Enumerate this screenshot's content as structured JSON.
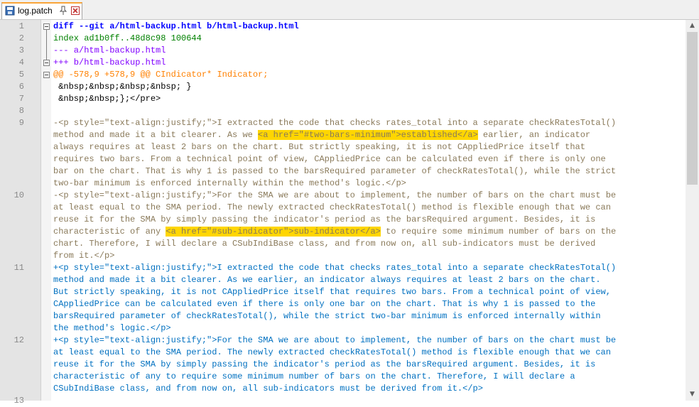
{
  "tab": {
    "label": "log.patch"
  },
  "lines": [
    {
      "num": "1",
      "cls": "c-blue",
      "rows": [
        [
          {
            "t": "diff --git a/html-backup.html b/html-backup.html"
          }
        ]
      ]
    },
    {
      "num": "2",
      "cls": "c-green",
      "rows": [
        [
          {
            "t": "index ad1b0ff..48d8c98 100644"
          }
        ]
      ]
    },
    {
      "num": "3",
      "cls": "c-purple",
      "rows": [
        [
          {
            "t": "--- a/html-backup.html"
          }
        ]
      ]
    },
    {
      "num": "4",
      "cls": "c-purple",
      "rows": [
        [
          {
            "t": "+++ b/html-backup.html"
          }
        ]
      ]
    },
    {
      "num": "5",
      "cls": "c-orange",
      "rows": [
        [
          {
            "t": "@@ -578,9 +578,9 @@ CIndicator* Indicator;"
          }
        ]
      ]
    },
    {
      "num": "6",
      "cls": "c-black",
      "rows": [
        [
          {
            "t": " &nbsp;&nbsp;&nbsp;&nbsp; }"
          }
        ]
      ]
    },
    {
      "num": "7",
      "cls": "c-black",
      "rows": [
        [
          {
            "t": " &nbsp;&nbsp;};</pre>"
          }
        ]
      ]
    },
    {
      "num": "8",
      "cls": "c-black",
      "rows": [
        [
          {
            "t": ""
          }
        ]
      ]
    },
    {
      "num": "9",
      "cls": "c-del",
      "rows": [
        [
          {
            "t": "-<p style=\"text-align:justify;\">I extracted the code that checks rates_total into a separate checkRatesTotal()"
          }
        ],
        [
          {
            "t": "method and made it a bit clearer. As we "
          },
          {
            "t": "<a href=\"#two-bars-minimum\">established</a>",
            "h": true
          },
          {
            "t": " earlier, an indicator"
          }
        ],
        [
          {
            "t": "always requires at least 2 bars on the chart. But strictly speaking, it is not CAppliedPrice itself that"
          }
        ],
        [
          {
            "t": "requires two bars. From a technical point of view, CAppliedPrice can be calculated even if there is only one"
          }
        ],
        [
          {
            "t": "bar on the chart. That is why 1 is passed to the barsRequired parameter of checkRatesTotal(), while the strict"
          }
        ],
        [
          {
            "t": "two-bar minimum is enforced internally within the method's logic.</p>"
          }
        ]
      ]
    },
    {
      "num": "10",
      "cls": "c-del",
      "rows": [
        [
          {
            "t": "-<p style=\"text-align:justify;\">For the SMA we are about to implement, the number of bars on the chart must be"
          }
        ],
        [
          {
            "t": "at least equal to the SMA period. The newly extracted checkRatesTotal() method is flexible enough that we can"
          }
        ],
        [
          {
            "t": "reuse it for the SMA by simply passing the indicator's period as the barsRequired argument. Besides, it is"
          }
        ],
        [
          {
            "t": "characteristic of any "
          },
          {
            "t": "<a href=\"#sub-indicator\">sub-indicator</a>",
            "h": true
          },
          {
            "t": " to require some minimum number of bars on the"
          }
        ],
        [
          {
            "t": "chart. Therefore, I will declare a CSubIndiBase class, and from now on, all sub-indicators must be derived"
          }
        ],
        [
          {
            "t": "from it.</p>"
          }
        ]
      ]
    },
    {
      "num": "11",
      "cls": "c-add",
      "rows": [
        [
          {
            "t": "+<p style=\"text-align:justify;\">I extracted the code that checks rates_total into a separate checkRatesTotal()"
          }
        ],
        [
          {
            "t": "method and made it a bit clearer. As we earlier, an indicator always requires at least 2 bars on the chart."
          }
        ],
        [
          {
            "t": "But strictly speaking, it is not CAppliedPrice itself that requires two bars. From a technical point of view,"
          }
        ],
        [
          {
            "t": "CAppliedPrice can be calculated even if there is only one bar on the chart. That is why 1 is passed to the"
          }
        ],
        [
          {
            "t": "barsRequired parameter of checkRatesTotal(), while the strict two-bar minimum is enforced internally within"
          }
        ],
        [
          {
            "t": "the method's logic.</p>"
          }
        ]
      ]
    },
    {
      "num": "12",
      "cls": "c-add",
      "rows": [
        [
          {
            "t": "+<p style=\"text-align:justify;\">For the SMA we are about to implement, the number of bars on the chart must be"
          }
        ],
        [
          {
            "t": "at least equal to the SMA period. The newly extracted checkRatesTotal() method is flexible enough that we can"
          }
        ],
        [
          {
            "t": "reuse it for the SMA by simply passing the indicator's period as the barsRequired argument. Besides, it is"
          }
        ],
        [
          {
            "t": "characteristic of any to require some minimum number of bars on the chart. Therefore, I will declare a"
          }
        ],
        [
          {
            "t": "CSubIndiBase class, and from now on, all sub-indicators must be derived from it.</p>"
          }
        ]
      ]
    },
    {
      "num": "13",
      "cls": "c-black",
      "rows": [
        [
          {
            "t": ""
          }
        ]
      ]
    }
  ]
}
